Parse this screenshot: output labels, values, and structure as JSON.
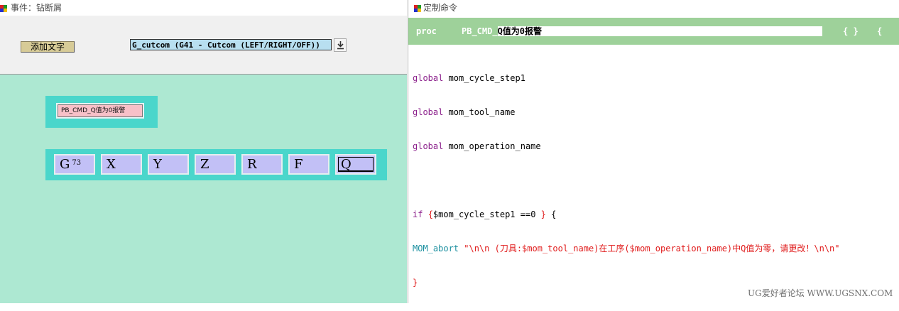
{
  "left_window": {
    "title": "事件：钻断屑",
    "add_text_label": "添加文字",
    "event_select_value": "G_cutcom (G41 - Cutcom (LEFT/RIGHT/OFF))",
    "text_field_value": "PB_CMD_Q值为0报警",
    "param_boxes": [
      {
        "letter": "G",
        "sup": "73"
      },
      {
        "letter": "X",
        "sup": ""
      },
      {
        "letter": "Y",
        "sup": ""
      },
      {
        "letter": "Z",
        "sup": ""
      },
      {
        "letter": "R",
        "sup": ""
      },
      {
        "letter": "F",
        "sup": ""
      },
      {
        "letter": "Q",
        "sup": ""
      }
    ]
  },
  "right_window": {
    "title": "定制命令",
    "proc_keyword": "proc",
    "proc_name_prefix": "PB_CMD_",
    "proc_name_rest": "Q值为0报警",
    "braces": "{ }",
    "brace_open": "{",
    "code": {
      "g1_kw": "global",
      "g1_var": " mom_cycle_step1",
      "g2_kw": "global",
      "g2_var": " mom_tool_name",
      "g3_kw": "global",
      "g3_var": " mom_operation_name",
      "if_kw": "if ",
      "if_open": "{",
      "if_cond": "$mom_cycle_step1 ==0 ",
      "if_close": "}",
      "if_brace": " {",
      "abort_cmd": "MOM_abort",
      "abort_str": " \"\\n\\n (刀具:$mom_tool_name)在工序($mom_operation_name)中Q值为零，请更改！\\n\\n\"",
      "end_brace": "}"
    }
  },
  "watermark": "UG爱好者论坛 WWW.UGSNX.COM",
  "colors": {
    "left_bg": "#ade8d2",
    "frame": "#4ad6cb",
    "param_fill": "#c2c0f6",
    "text_field_fill": "#f8c0c8",
    "proc_bar": "#9ed19a"
  }
}
